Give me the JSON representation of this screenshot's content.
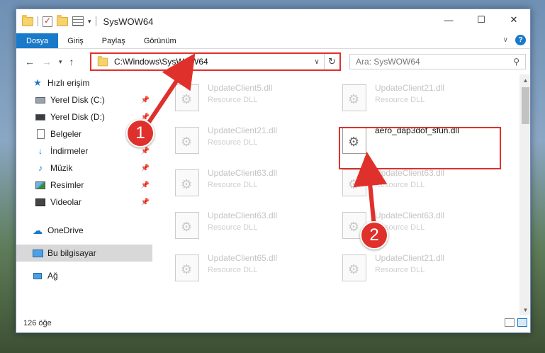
{
  "window": {
    "title": "SysWOW64",
    "controls": {
      "minimize": "—",
      "maximize": "☐",
      "close": "✕"
    }
  },
  "ribbon": {
    "tabs": [
      "Dosya",
      "Giriş",
      "Paylaş",
      "Görünüm"
    ],
    "active_tab": "Dosya",
    "help": "?"
  },
  "address": {
    "path": "C:\\Windows\\SysWOW64",
    "search_placeholder": "Ara: SysWOW64"
  },
  "nav_pane": {
    "quick_access": "Hızlı erişim",
    "items": [
      {
        "label": "Yerel Disk (C:)",
        "icon": "drive-icon"
      },
      {
        "label": "Yerel Disk (D:)",
        "icon": "drive-icon"
      },
      {
        "label": "Belgeler",
        "icon": "documents-icon"
      },
      {
        "label": "İndirmeler",
        "icon": "download-icon"
      },
      {
        "label": "Müzik",
        "icon": "music-icon"
      },
      {
        "label": "Resimler",
        "icon": "pictures-icon"
      },
      {
        "label": "Videolar",
        "icon": "videos-icon"
      }
    ],
    "onedrive": "OneDrive",
    "this_pc": "Bu bilgisayar",
    "network": "Ağ"
  },
  "files": {
    "items": [
      {
        "name": "UpdateClient5.dll",
        "type": "Resource DLL"
      },
      {
        "name": "UpdateClient21.dll",
        "type": "Resource DLL"
      },
      {
        "name": "UpdateClient21.dll",
        "type": "Resource DLL"
      },
      {
        "name": "aero_dap3dof_sfun.dll",
        "type": ""
      },
      {
        "name": "UpdateClient63.dll",
        "type": "Resource DLL"
      },
      {
        "name": "UpdateClient63.dll",
        "type": "Resource DLL"
      },
      {
        "name": "UpdateClient63.dll",
        "type": "Resource DLL"
      },
      {
        "name": "UpdateClient63.dll",
        "type": "Resource DLL"
      },
      {
        "name": "UpdateClient65.dll",
        "type": "Resource DLL"
      },
      {
        "name": "UpdateClient21.dll",
        "type": "Resource DLL"
      }
    ]
  },
  "status": {
    "count": "126 öğe"
  },
  "callouts": [
    "1",
    "2"
  ],
  "colors": {
    "accent": "#1979ca",
    "highlight": "#e0302b"
  }
}
